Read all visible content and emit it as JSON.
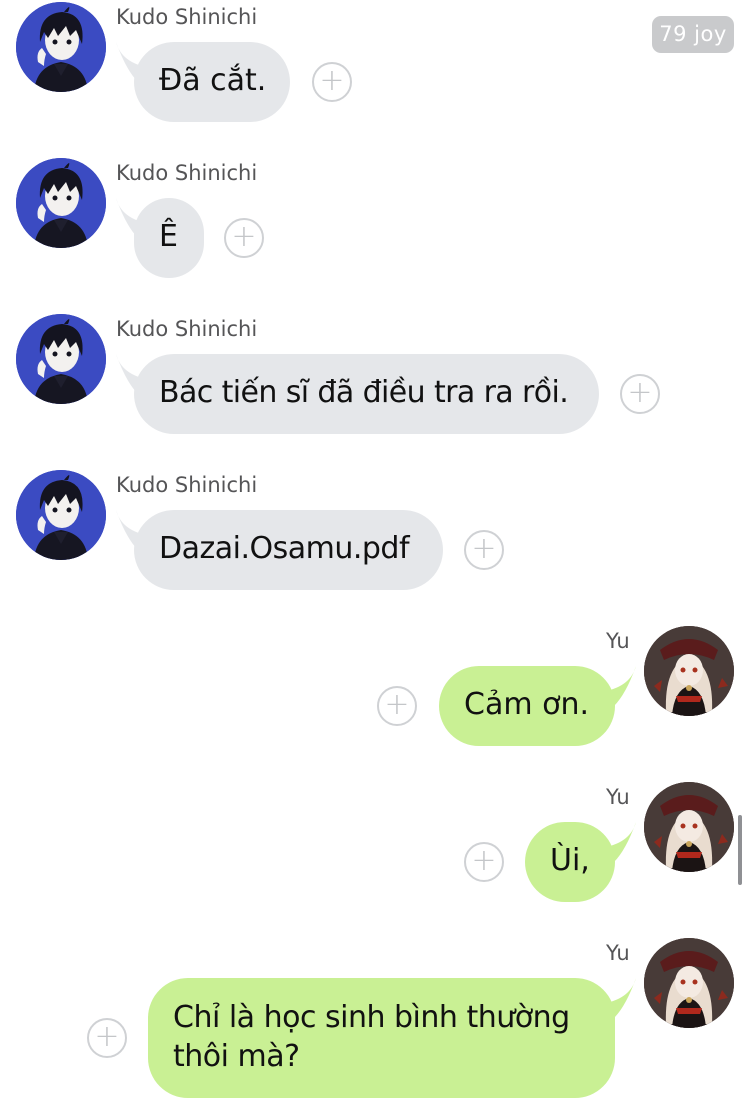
{
  "header": {
    "badge_text": "79 joy"
  },
  "contacts": {
    "other": "Kudo Shinichi",
    "me": "Yu"
  },
  "messages": [
    {
      "sender": "Kudo Shinichi",
      "text": "Đã cắt."
    },
    {
      "sender": "Kudo Shinichi",
      "text": "Ê"
    },
    {
      "sender": "Kudo Shinichi",
      "text": "Bác tiến sĩ đã điều tra ra rồi."
    },
    {
      "sender": "Kudo Shinichi",
      "text": "Dazai.Osamu.pdf"
    },
    {
      "sender": "Yu",
      "text": "Cảm ơn."
    },
    {
      "sender": "Yu",
      "text": "Ùi,"
    },
    {
      "sender": "Yu",
      "text": "Chỉ là học sinh bình thường",
      "text_line2": "thôi mà?"
    }
  ],
  "icons": {
    "add_reaction": "plus-circle-icon",
    "avatar_other": "anime-boy-avatar",
    "avatar_me": "gothic-girl-avatar"
  },
  "colors": {
    "incoming_bubble": "#e5e7ea",
    "outgoing_bubble": "#c9f094",
    "avatar_other_bg": "#3b4bc2"
  }
}
